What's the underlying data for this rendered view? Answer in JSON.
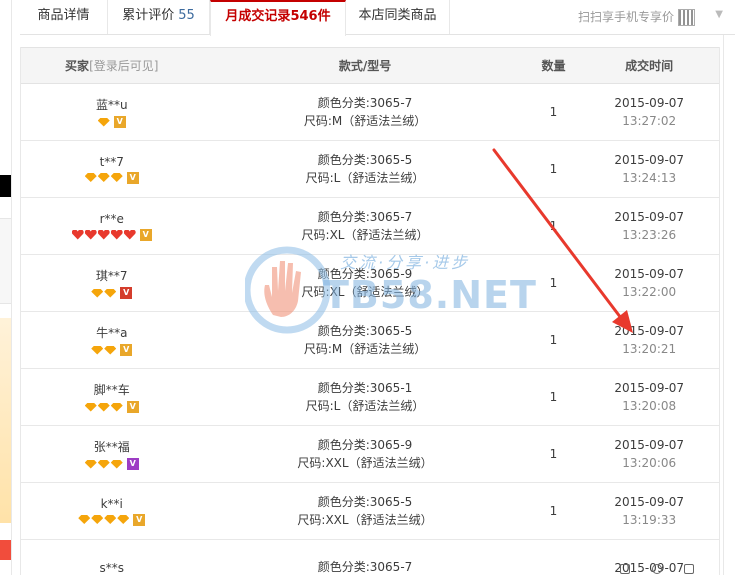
{
  "tabs": {
    "detail": "商品详情",
    "reviews": "累计评价",
    "reviews_count": "55",
    "records": "月成交记录",
    "records_count": "546件",
    "similar": "本店同类商品"
  },
  "scan_text": "扫扫享手机专享价",
  "table": {
    "headers": {
      "buyer": "买家",
      "buyer_hint": "[登录后可见]",
      "style": "款式/型号",
      "qty": "数量",
      "time": "成交时间"
    },
    "rows": [
      {
        "buyer": "蓝**u",
        "badges": [
          "diamond"
        ],
        "badge_count": 1,
        "vip": "gold",
        "color": "颜色分类:3065-7",
        "size": "尺码:M（舒适法兰绒）",
        "qty": "1",
        "date": "2015-09-07",
        "time": "13:27:02"
      },
      {
        "buyer": "t**7",
        "badges": [
          "diamond",
          "diamond",
          "diamond"
        ],
        "vip": "gold",
        "color": "颜色分类:3065-5",
        "size": "尺码:L（舒适法兰绒）",
        "qty": "1",
        "date": "2015-09-07",
        "time": "13:24:13"
      },
      {
        "buyer": "r**e",
        "badges": [
          "heart",
          "heart",
          "heart",
          "heart",
          "heart"
        ],
        "vip": "gold",
        "color": "颜色分类:3065-7",
        "size": "尺码:XL（舒适法兰绒）",
        "qty": "1",
        "date": "2015-09-07",
        "time": "13:23:26"
      },
      {
        "buyer": "琪**7",
        "badges": [
          "diamond",
          "diamond"
        ],
        "vip": "red",
        "color": "颜色分类:3065-9",
        "size": "尺码:XL（舒适法兰绒）",
        "qty": "1",
        "date": "2015-09-07",
        "time": "13:22:00"
      },
      {
        "buyer": "牛**a",
        "badges": [
          "diamond",
          "diamond"
        ],
        "vip": "gold",
        "color": "颜色分类:3065-5",
        "size": "尺码:M（舒适法兰绒）",
        "qty": "1",
        "date": "2015-09-07",
        "time": "13:20:21"
      },
      {
        "buyer": "脚**车",
        "badges": [
          "diamond",
          "diamond",
          "diamond"
        ],
        "vip": "gold",
        "color": "颜色分类:3065-1",
        "size": "尺码:L（舒适法兰绒）",
        "qty": "1",
        "date": "2015-09-07",
        "time": "13:20:08"
      },
      {
        "buyer": "张**福",
        "badges": [
          "diamond",
          "diamond",
          "diamond"
        ],
        "vip": "purple",
        "color": "颜色分类:3065-9",
        "size": "尺码:XXL（舒适法兰绒）",
        "qty": "1",
        "date": "2015-09-07",
        "time": "13:20:06"
      },
      {
        "buyer": "k**i",
        "badges": [
          "diamond",
          "diamond",
          "diamond",
          "diamond"
        ],
        "vip": "gold",
        "color": "颜色分类:3065-5",
        "size": "尺码:XXL（舒适法兰绒）",
        "qty": "1",
        "date": "2015-09-07",
        "time": "13:19:33"
      },
      {
        "buyer": "s**s",
        "badges": [],
        "vip": "",
        "color": "颜色分类:3065-7",
        "size": "",
        "qty": "",
        "date": "2015-09-07",
        "time": ""
      }
    ]
  },
  "watermark": {
    "slogan": "交流·分享·进步",
    "text": "TB58.NET"
  },
  "colors": {
    "accent": "#c40000",
    "link": "#3d6b9e",
    "arrow": "#e8392d"
  }
}
